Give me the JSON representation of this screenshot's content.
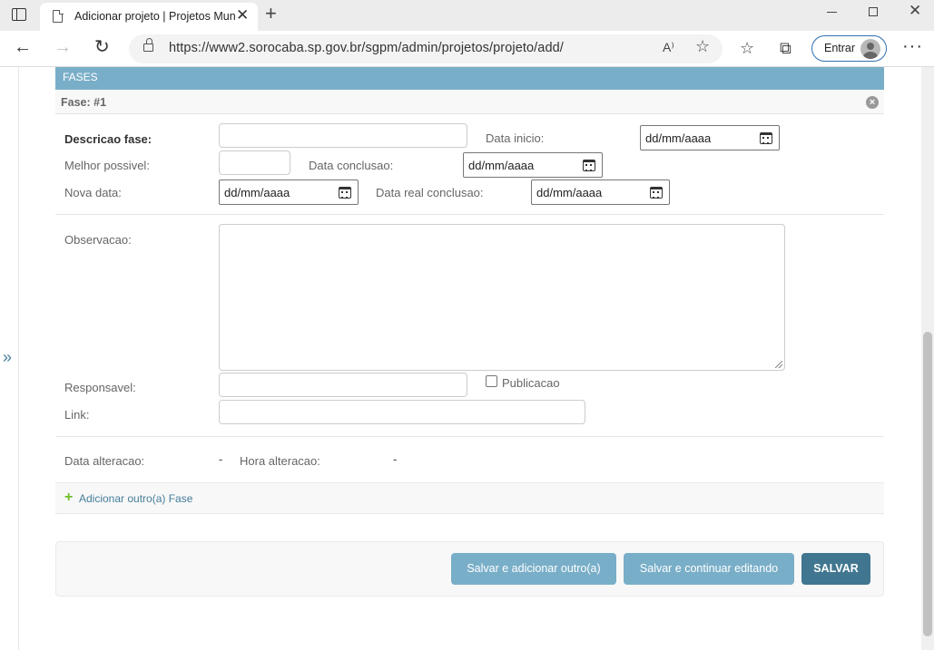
{
  "browser": {
    "tab_title": "Adicionar projeto | Projetos Municipais",
    "url": "https://www2.sorocaba.sp.gov.br/sgpm/admin/projetos/projeto/add/",
    "read_aloud_label": "A⁾",
    "signin_label": "Entrar",
    "icons": {
      "tab_close": "✕",
      "new_tab": "+",
      "window_close": "✕",
      "back": "←",
      "forward": "→",
      "reload": "↻",
      "fav_add": "☆",
      "favorites": "☆",
      "collections": "⧉",
      "more": "···"
    }
  },
  "sidebar": {
    "toggle_label": "»"
  },
  "inline": {
    "section_title": "FASES",
    "item_title": "Fase: #1",
    "delete_glyph": "×"
  },
  "form": {
    "descricao_label": "Descricao fase:",
    "data_inicio_label": "Data inicio:",
    "data_inicio_value": "dd/mm/aaaa",
    "melhor_possivel_label": "Melhor possivel:",
    "data_conclusao_label": "Data conclusao:",
    "data_conclusao_value": "dd/mm/aaaa",
    "nova_data_label": "Nova data:",
    "nova_data_value": "dd/mm/aaaa",
    "data_real_conclusao_label": "Data real conclusao:",
    "data_real_conclusao_value": "dd/mm/aaaa",
    "observacao_label": "Observacao:",
    "responsavel_label": "Responsavel:",
    "publicacao_label": "Publicacao",
    "link_label": "Link:",
    "data_alteracao_label": "Data alteracao:",
    "data_alteracao_value": "-",
    "hora_alteracao_label": "Hora alteracao:",
    "hora_alteracao_value": "-"
  },
  "add_another": {
    "icon": "+",
    "label": "Adicionar outro(a) Fase"
  },
  "submit": {
    "save_add_another": "Salvar e adicionar outro(a)",
    "save_continue": "Salvar e continuar editando",
    "save": "SALVAR"
  },
  "colors": {
    "header_blue": "#79aec8",
    "button_dark": "#417690",
    "link_blue": "#447e9b",
    "add_green": "#70bf2b"
  }
}
